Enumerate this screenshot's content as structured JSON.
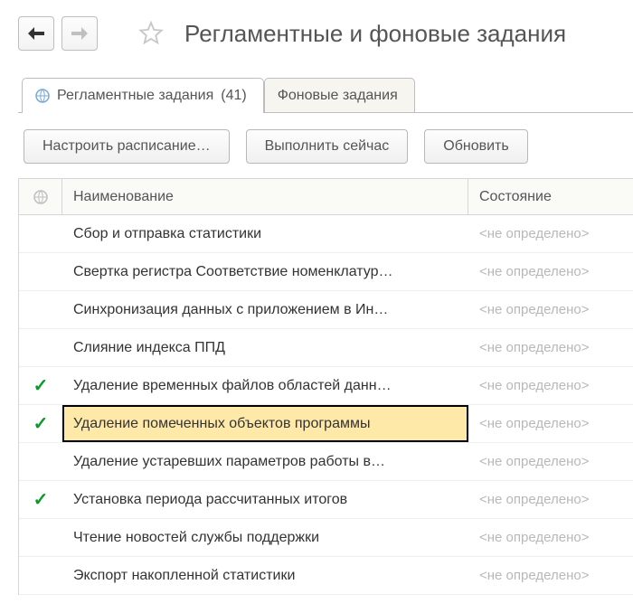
{
  "title": "Регламентные и фоновые задания",
  "tabs": [
    {
      "label": "Регламентные задания",
      "count": "(41)",
      "active": true
    },
    {
      "label": "Фоновые задания",
      "active": false
    }
  ],
  "buttons": {
    "schedule": "Настроить расписание…",
    "run_now": "Выполнить сейчас",
    "refresh": "Обновить"
  },
  "columns": {
    "name": "Наименование",
    "state": "Состояние"
  },
  "state_placeholder": "<не определено>",
  "rows": [
    {
      "checked": false,
      "name": "Сбор и отправка статистики",
      "highlight": false
    },
    {
      "checked": false,
      "name": "Свертка регистра Соответствие номенклатур…",
      "highlight": false
    },
    {
      "checked": false,
      "name": "Синхронизация данных с приложением в Ин…",
      "highlight": false
    },
    {
      "checked": false,
      "name": "Слияние индекса ППД",
      "highlight": false
    },
    {
      "checked": true,
      "name": "Удаление временных файлов областей данн…",
      "highlight": false
    },
    {
      "checked": true,
      "name": "Удаление помеченных объектов программы",
      "highlight": true
    },
    {
      "checked": false,
      "name": "Удаление устаревших параметров работы в…",
      "highlight": false
    },
    {
      "checked": true,
      "name": "Установка периода рассчитанных итогов",
      "highlight": false
    },
    {
      "checked": false,
      "name": "Чтение новостей службы поддержки",
      "highlight": false
    },
    {
      "checked": false,
      "name": "Экспорт накопленной статистики",
      "highlight": false
    }
  ]
}
